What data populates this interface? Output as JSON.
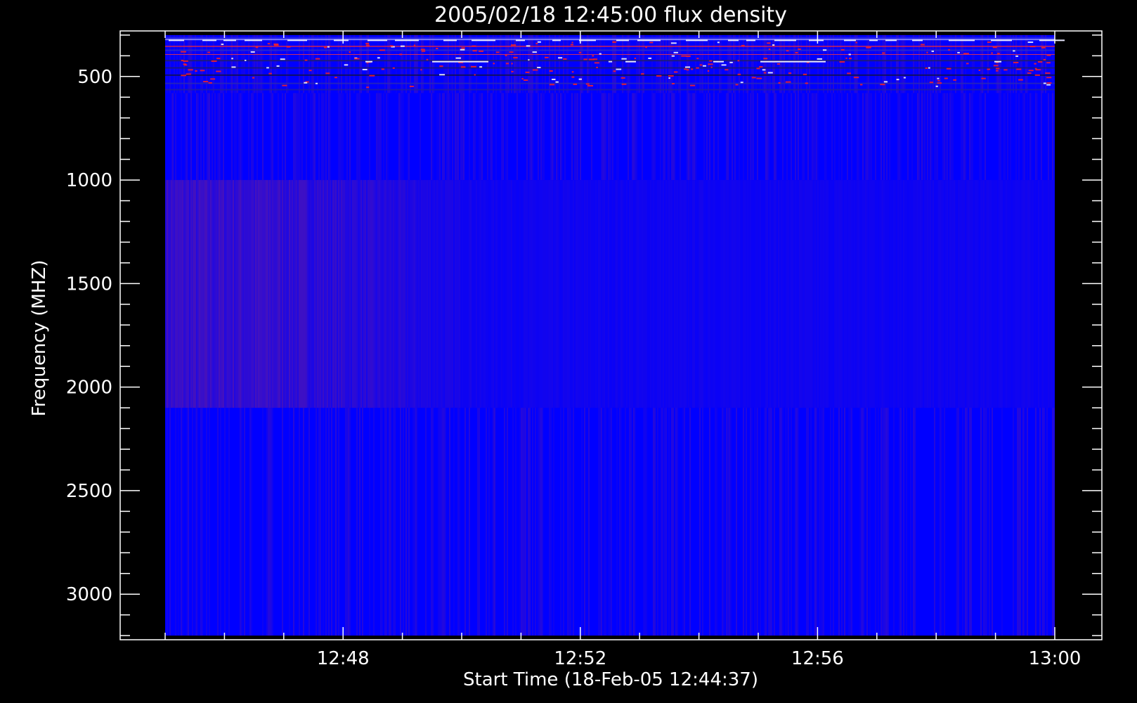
{
  "chart_data": {
    "type": "heatmap",
    "title": "2005/02/18 12:45:00 flux density",
    "xlabel": "Start Time (18-Feb-05 12:44:37)",
    "ylabel": "Frequency (MHZ)",
    "x_range": [
      "12:44:37",
      "13:00:00"
    ],
    "y_range_mhz": [
      280,
      3220
    ],
    "y_axis_reversed": true,
    "x_tick_labels": [
      {
        "label": "12:48",
        "minute": 48
      },
      {
        "label": "12:52",
        "minute": 52
      },
      {
        "label": "12:56",
        "minute": 56
      },
      {
        "label": "13:00",
        "minute": 60
      }
    ],
    "y_tick_labels": [
      500,
      1000,
      1500,
      2000,
      2500,
      3000
    ],
    "data_extent": {
      "time_start": "12:45:00",
      "time_end": "13:00:00",
      "freq_min_mhz": 300,
      "freq_max_mhz": 3200
    },
    "bands": [
      {
        "freq_range_mhz": [
          300,
          580
        ],
        "appearance": "noisy blue with red interference lines"
      },
      {
        "freq_range_mhz": [
          580,
          1000
        ],
        "appearance": "blue with faint red striping"
      },
      {
        "freq_range_mhz": [
          1000,
          2100
        ],
        "appearance": "purple-tinted on left, blue on right"
      },
      {
        "freq_range_mhz": [
          2100,
          3200
        ],
        "appearance": "blue with faint red striping"
      }
    ],
    "colors": {
      "background": "#000000",
      "low": "#0000ff",
      "high": "#ff0000",
      "axes": "#ffffff"
    },
    "grid": false
  }
}
